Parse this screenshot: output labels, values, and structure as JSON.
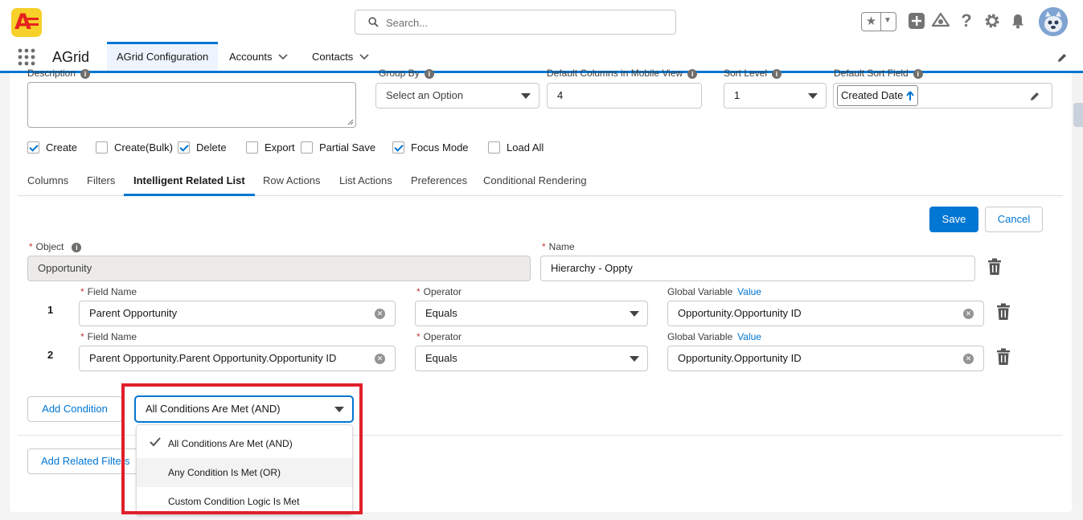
{
  "header": {
    "search_placeholder": "Search...",
    "logo_letter": "A"
  },
  "nav": {
    "app_name": "AGrid",
    "tabs": [
      {
        "label": "AGrid Configuration",
        "active": true
      },
      {
        "label": "Accounts"
      },
      {
        "label": "Contacts"
      }
    ]
  },
  "settings": {
    "description_label": "Description",
    "group_by_label": "Group By",
    "group_by_value": "Select an Option",
    "default_columns_label": "Default Columns in Mobile View",
    "default_columns_value": "4",
    "sort_level_label": "Sort Level",
    "sort_level_value": "1",
    "default_sort_field_label": "Default Sort Field",
    "default_sort_field_value": "Created Date",
    "checkboxes": [
      {
        "label": "Create",
        "checked": true
      },
      {
        "label": "Create(Bulk)",
        "checked": false
      },
      {
        "label": "Delete",
        "checked": true
      },
      {
        "label": "Export",
        "checked": false
      },
      {
        "label": "Partial Save",
        "checked": false
      },
      {
        "label": "Focus Mode",
        "checked": true
      },
      {
        "label": "Load All",
        "checked": false
      }
    ]
  },
  "tabs": [
    {
      "label": "Columns"
    },
    {
      "label": "Filters"
    },
    {
      "label": "Intelligent Related List",
      "active": true
    },
    {
      "label": "Row Actions"
    },
    {
      "label": "List Actions"
    },
    {
      "label": "Preferences"
    },
    {
      "label": "Conditional Rendering"
    }
  ],
  "actions": {
    "save": "Save",
    "cancel": "Cancel"
  },
  "form": {
    "object_label": "Object",
    "object_value": "Opportunity",
    "name_label": "Name",
    "name_value": "Hierarchy - Oppty"
  },
  "conditions": [
    {
      "num": "1",
      "field_label": "Field Name",
      "field_value": "Parent Opportunity",
      "operator_label": "Operator",
      "operator_value": "Equals",
      "global_label": "Global Variable",
      "global_link": "Value",
      "global_value": "Opportunity.Opportunity ID"
    },
    {
      "num": "2",
      "field_label": "Field Name",
      "field_value": "Parent Opportunity.Parent Opportunity.Opportunity ID",
      "operator_label": "Operator",
      "operator_value": "Equals",
      "global_label": "Global Variable",
      "global_link": "Value",
      "global_value": "Opportunity.Opportunity ID"
    }
  ],
  "logic": {
    "add_condition": "Add Condition",
    "selected": "All Conditions Are Met (AND)",
    "options": [
      {
        "label": "All Conditions Are Met (AND)",
        "selected": true
      },
      {
        "label": "Any Condition Is Met (OR)",
        "hover": true
      },
      {
        "label": "Custom Condition Logic Is Met"
      }
    ]
  },
  "add_related_filters": "Add Related Filters",
  "colors": {
    "brand": "#0176d3",
    "highlight": "#e0202a"
  }
}
